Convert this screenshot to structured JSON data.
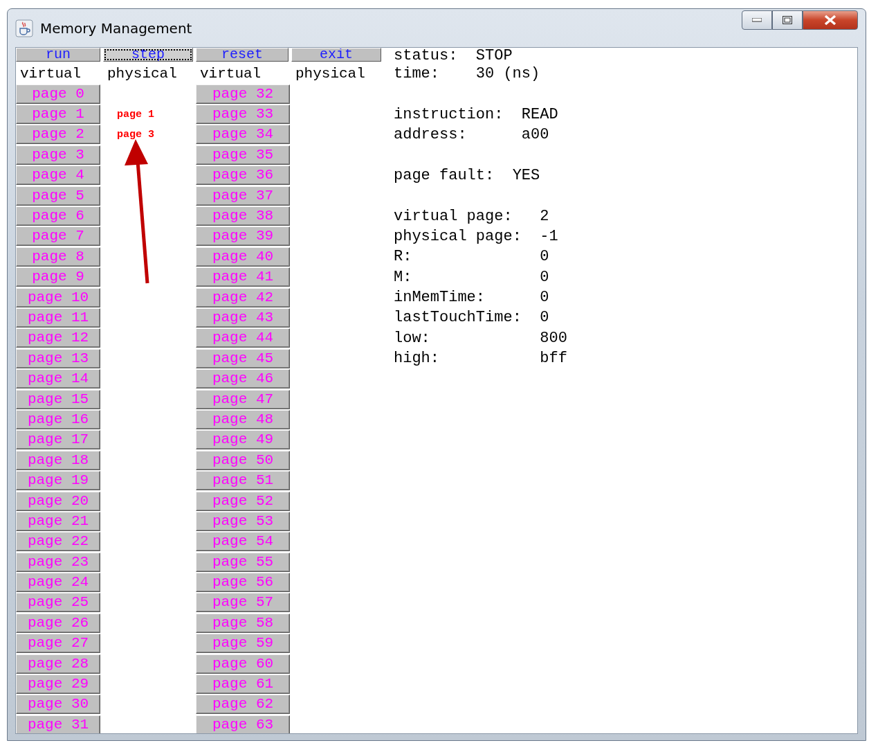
{
  "window": {
    "title": "Memory Management"
  },
  "toolbar": [
    {
      "label": "run",
      "focused": false
    },
    {
      "label": "step",
      "focused": true
    },
    {
      "label": "reset",
      "focused": false
    },
    {
      "label": "exit",
      "focused": false
    }
  ],
  "headers": [
    "virtual",
    "physical",
    "virtual",
    "physical"
  ],
  "rows": [
    {
      "virtual_left": "page 0",
      "virtual_right": "page 32"
    },
    {
      "virtual_left": "page 1",
      "physical_left": "page 1",
      "virtual_right": "page 33"
    },
    {
      "virtual_left": "page 2",
      "physical_left": "page 3",
      "virtual_right": "page 34"
    },
    {
      "virtual_left": "page 3",
      "virtual_right": "page 35"
    },
    {
      "virtual_left": "page 4",
      "virtual_right": "page 36"
    },
    {
      "virtual_left": "page 5",
      "virtual_right": "page 37"
    },
    {
      "virtual_left": "page 6",
      "virtual_right": "page 38"
    },
    {
      "virtual_left": "page 7",
      "virtual_right": "page 39"
    },
    {
      "virtual_left": "page 8",
      "virtual_right": "page 40"
    },
    {
      "virtual_left": "page 9",
      "virtual_right": "page 41"
    },
    {
      "virtual_left": "page 10",
      "virtual_right": "page 42"
    },
    {
      "virtual_left": "page 11",
      "virtual_right": "page 43"
    },
    {
      "virtual_left": "page 12",
      "virtual_right": "page 44"
    },
    {
      "virtual_left": "page 13",
      "virtual_right": "page 45"
    },
    {
      "virtual_left": "page 14",
      "virtual_right": "page 46"
    },
    {
      "virtual_left": "page 15",
      "virtual_right": "page 47"
    },
    {
      "virtual_left": "page 16",
      "virtual_right": "page 48"
    },
    {
      "virtual_left": "page 17",
      "virtual_right": "page 49"
    },
    {
      "virtual_left": "page 18",
      "virtual_right": "page 50"
    },
    {
      "virtual_left": "page 19",
      "virtual_right": "page 51"
    },
    {
      "virtual_left": "page 20",
      "virtual_right": "page 52"
    },
    {
      "virtual_left": "page 21",
      "virtual_right": "page 53"
    },
    {
      "virtual_left": "page 22",
      "virtual_right": "page 54"
    },
    {
      "virtual_left": "page 23",
      "virtual_right": "page 55"
    },
    {
      "virtual_left": "page 24",
      "virtual_right": "page 56"
    },
    {
      "virtual_left": "page 25",
      "virtual_right": "page 57"
    },
    {
      "virtual_left": "page 26",
      "virtual_right": "page 58"
    },
    {
      "virtual_left": "page 27",
      "virtual_right": "page 59"
    },
    {
      "virtual_left": "page 28",
      "virtual_right": "page 60"
    },
    {
      "virtual_left": "page 29",
      "virtual_right": "page 61"
    },
    {
      "virtual_left": "page 30",
      "virtual_right": "page 62"
    },
    {
      "virtual_left": "page 31",
      "virtual_right": "page 63"
    }
  ],
  "info_groups": [
    [
      {
        "label": "status:",
        "value": "STOP"
      },
      {
        "label": "time:",
        "value": "30 (ns)"
      }
    ],
    [
      {
        "label": "instruction:",
        "value": "READ"
      },
      {
        "label": "address:",
        "value": "a00"
      }
    ],
    [
      {
        "label": "page fault:",
        "value": "YES"
      }
    ],
    [
      {
        "label": "virtual page:",
        "value": "2"
      },
      {
        "label": "physical page:",
        "value": "-1"
      },
      {
        "label": "R:",
        "value": "0"
      },
      {
        "label": "M:",
        "value": "0"
      },
      {
        "label": "inMemTime:",
        "value": "0"
      },
      {
        "label": "lastTouchTime:",
        "value": "0"
      },
      {
        "label": "low:",
        "value": "800"
      },
      {
        "label": "high:",
        "value": "bff"
      }
    ]
  ]
}
